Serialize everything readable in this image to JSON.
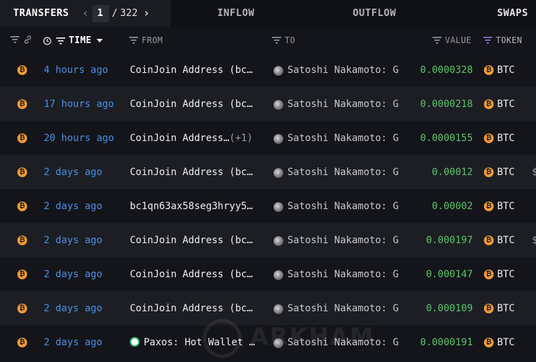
{
  "tabs": {
    "transfers": "TRANSFERS",
    "inflow": "INFLOW",
    "outflow": "OUTFLOW",
    "swaps": "SWAPS"
  },
  "pager": {
    "current": "1",
    "separator": "/",
    "total": "322"
  },
  "columns": {
    "time": "TIME",
    "from": "FROM",
    "to": "TO",
    "value": "VALUE",
    "token": "TOKEN"
  },
  "rows": [
    {
      "time": "4 hours ago",
      "from": "CoinJoin Address (bc…",
      "from_extra": "",
      "to": "Satoshi Nakamoto: G",
      "value": "0.0000328",
      "token": "BTC",
      "usd": ""
    },
    {
      "time": "17 hours ago",
      "from": "CoinJoin Address (bc…",
      "from_extra": "",
      "to": "Satoshi Nakamoto: G",
      "value": "0.0000218",
      "token": "BTC",
      "usd": ""
    },
    {
      "time": "20 hours ago",
      "from": "CoinJoin Address…",
      "from_extra": "(+1)",
      "to": "Satoshi Nakamoto: G",
      "value": "0.0000155",
      "token": "BTC",
      "usd": ""
    },
    {
      "time": "2 days ago",
      "from": "CoinJoin Address (bc…",
      "from_extra": "",
      "to": "Satoshi Nakamoto: G",
      "value": "0.00012",
      "token": "BTC",
      "usd": "$"
    },
    {
      "time": "2 days ago",
      "from": "bc1qn63ax58seg3hryy5…",
      "from_extra": "",
      "to": "Satoshi Nakamoto: G",
      "value": "0.00002",
      "token": "BTC",
      "usd": ""
    },
    {
      "time": "2 days ago",
      "from": "CoinJoin Address (bc…",
      "from_extra": "",
      "to": "Satoshi Nakamoto: G",
      "value": "0.000197",
      "token": "BTC",
      "usd": "$"
    },
    {
      "time": "2 days ago",
      "from": "CoinJoin Address (bc…",
      "from_extra": "",
      "to": "Satoshi Nakamoto: G",
      "value": "0.000147",
      "token": "BTC",
      "usd": ""
    },
    {
      "time": "2 days ago",
      "from": "CoinJoin Address (bc…",
      "from_extra": "",
      "to": "Satoshi Nakamoto: G",
      "value": "0.000109",
      "token": "BTC",
      "usd": ""
    },
    {
      "time": "2 days ago",
      "from": "Paxos: Hot Wallet …",
      "from_extra": "",
      "from_icon": "paxos-icon",
      "to": "Satoshi Nakamoto: G",
      "value": "0.0000191",
      "token": "BTC",
      "usd": ""
    }
  ],
  "icons": {
    "chain": "btc-icon",
    "to_entity": "satoshi-avatar-icon",
    "token": "btc-icon"
  },
  "watermark": "ARKHAM",
  "colors": {
    "time_link": "#4a8fe8",
    "value_positive": "#5ec46a",
    "btc": "#f29a36"
  }
}
